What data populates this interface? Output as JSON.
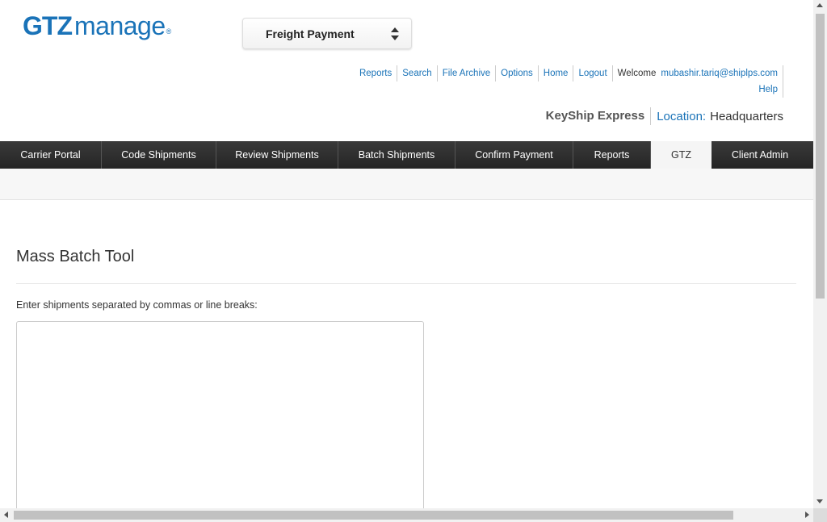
{
  "logo": {
    "gtz": "GTZ",
    "manage": "manage",
    "reg": "®"
  },
  "selector": {
    "label": "Freight Payment",
    "icon": "sort-arrows-icon"
  },
  "top_links": [
    "Reports",
    "Search",
    "File Archive",
    "Options",
    "Home",
    "Logout"
  ],
  "user": {
    "welcome": "Welcome",
    "email": "mubashir.tariq@shiplps.com"
  },
  "help": "Help",
  "company": {
    "name": "KeyShip Express",
    "location_label": "Location:",
    "location_value": "Headquarters"
  },
  "nav": {
    "tabs": [
      "Carrier Portal",
      "Code Shipments",
      "Review Shipments",
      "Batch Shipments",
      "Confirm Payment",
      "Reports",
      "GTZ",
      "Client Admin"
    ],
    "active": "GTZ"
  },
  "main": {
    "title": "Mass Batch Tool",
    "instructions": "Enter shipments separated by commas or line breaks:",
    "textarea_value": ""
  },
  "colors": {
    "brand": "#1a73b8",
    "nav_bg": "#2b2b2b",
    "active_tab_bg": "#f5f5f5"
  }
}
